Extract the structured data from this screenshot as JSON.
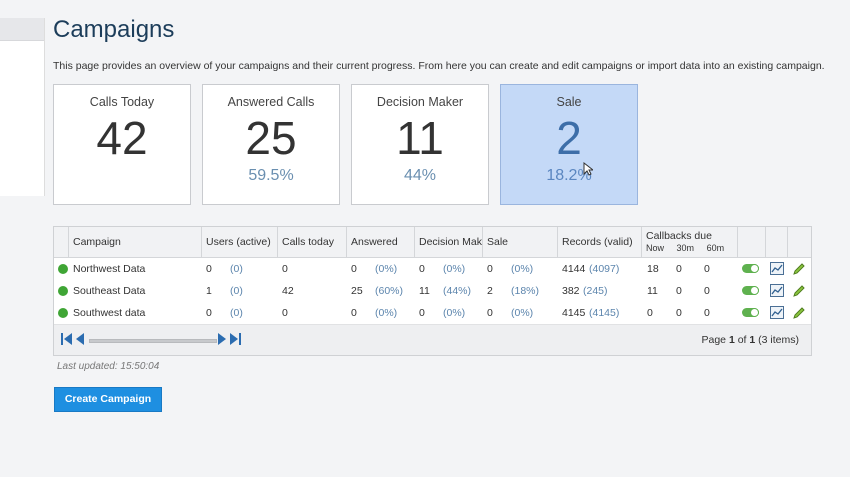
{
  "page": {
    "title": "Campaigns",
    "description": "This page provides an overview of your campaigns and their current progress. From here you can create and edit campaigns or import data into an existing campaign."
  },
  "stats": [
    {
      "label": "Calls Today",
      "value": "42",
      "pct": ""
    },
    {
      "label": "Answered Calls",
      "value": "25",
      "pct": "59.5%"
    },
    {
      "label": "Decision Maker",
      "value": "11",
      "pct": "44%"
    },
    {
      "label": "Sale",
      "value": "2",
      "pct": "18.2%"
    }
  ],
  "table": {
    "headers": {
      "campaign": "Campaign",
      "users": "Users (active)",
      "calls": "Calls today",
      "answered": "Answered",
      "decision": "Decision Maker",
      "sale": "Sale",
      "records": "Records (valid)",
      "callbacks": "Callbacks due",
      "cb_now": "Now",
      "cb_30m": "30m",
      "cb_60m": "60m"
    },
    "rows": [
      {
        "name": "Northwest Data",
        "users": "0",
        "users_active": "(0)",
        "calls": "0",
        "answered": "0",
        "answered_pct": "(0%)",
        "decision": "0",
        "decision_pct": "(0%)",
        "sale": "0",
        "sale_pct": "(0%)",
        "records": "4144",
        "records_valid": "(4097)",
        "cb_now": "18",
        "cb_30m": "0",
        "cb_60m": "0"
      },
      {
        "name": "Southeast Data",
        "users": "1",
        "users_active": "(0)",
        "calls": "42",
        "answered": "25",
        "answered_pct": "(60%)",
        "decision": "11",
        "decision_pct": "(44%)",
        "sale": "2",
        "sale_pct": "(18%)",
        "records": "382",
        "records_valid": "(245)",
        "cb_now": "11",
        "cb_30m": "0",
        "cb_60m": "0"
      },
      {
        "name": "Southwest data",
        "users": "0",
        "users_active": "(0)",
        "calls": "0",
        "answered": "0",
        "answered_pct": "(0%)",
        "decision": "0",
        "decision_pct": "(0%)",
        "sale": "0",
        "sale_pct": "(0%)",
        "records": "4145",
        "records_valid": "(4145)",
        "cb_now": "0",
        "cb_30m": "0",
        "cb_60m": "0"
      }
    ],
    "pager": {
      "prefix": "Page",
      "current": "1",
      "of": "of",
      "total": "1",
      "items": "(3 items)"
    }
  },
  "last_updated": "Last updated: 15:50:04",
  "create_button": "Create Campaign",
  "colors": {
    "accent": "#1e8fe1",
    "status_active": "#3fa535",
    "sale_card": "#c4d9f7"
  }
}
